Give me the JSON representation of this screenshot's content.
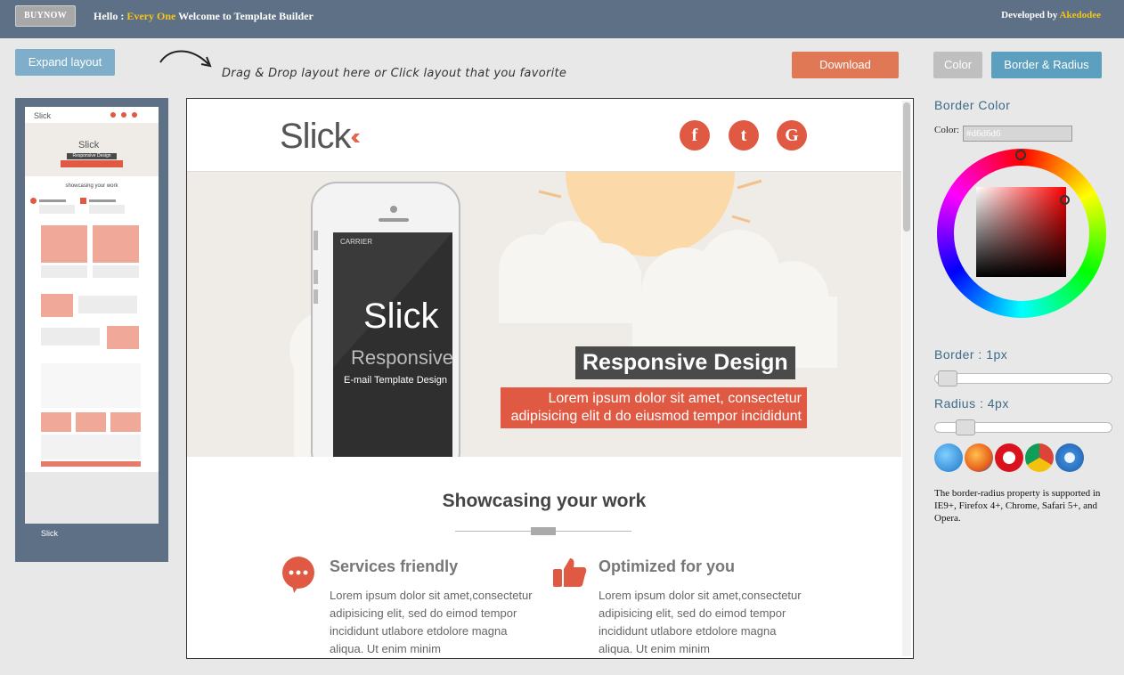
{
  "topbar": {
    "buy_now": "BUYNOW",
    "greeting_prefix": "Hello :",
    "greeting_name": "Every One",
    "greeting_suffix": "Welcome to Template Builder",
    "developer_prefix": "Developed by",
    "developer_name": "Akedodee"
  },
  "toolbar": {
    "expand_label": "Expand layout",
    "drag_hint": "Drag & Drop layout here or Click layout that you favorite",
    "download_label": "Download",
    "color_tab": "Color",
    "border_tab": "Border & Radius"
  },
  "email": {
    "logo": "Slick",
    "social": [
      "f",
      "t",
      "G"
    ],
    "headline": "Responsive Design",
    "subline": "Lorem ipsum dolor sit amet, consectetur adipisicing elit d do eiusmod tempor incididunt",
    "phone_title": "Slick",
    "phone_sub": "Responsive",
    "phone_caption": "E-mail Template Design",
    "phone_carrier": "CARRIER",
    "section_title": "Showcasing your work",
    "features": [
      {
        "title": "Services friendly",
        "text": "Lorem ipsum dolor sit amet,consectetur adipisicing elit, sed do eimod tempor incididunt utlabore etdolore magna aliqua. Ut enim minim"
      },
      {
        "title": "Optimized for you",
        "text": "Lorem ipsum dolor sit amet,consectetur adipisicing elit, sed do eimod tempor incididunt utlabore etdolore magna aliqua. Ut enim minim"
      }
    ]
  },
  "thumbnail": {
    "logo": "Slick",
    "title": "Responsive Design",
    "section": "showcasing your work"
  },
  "panel": {
    "border_color_heading": "Border Color",
    "color_label": "Color:",
    "color_value": "#d6d6d6",
    "border_label": "Border : 1px",
    "radius_label": "Radius : 4px",
    "border_value_px": 1,
    "radius_value_px": 4,
    "browsers": [
      "ie-icon",
      "firefox-icon",
      "opera-icon",
      "chrome-icon",
      "safari-icon"
    ],
    "support_note": "The border-radius property is supported in IE9+, Firefox 4+, Chrome, Safari 5+, and Opera."
  },
  "colors": {
    "accent": "#e05a43",
    "topbar": "#5e7085",
    "download": "#e07856",
    "blue_button": "#5c9fbf"
  }
}
